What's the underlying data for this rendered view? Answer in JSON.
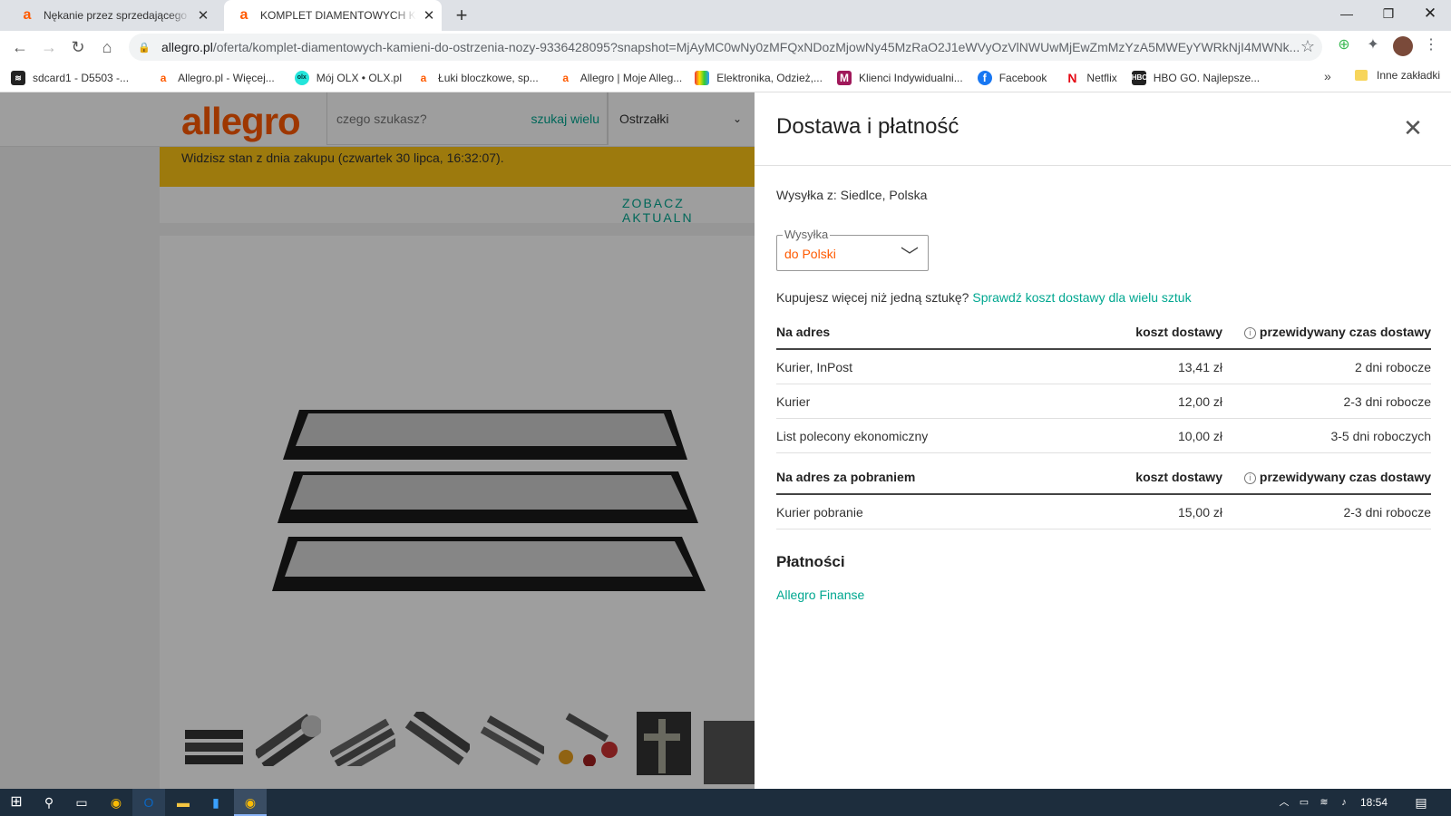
{
  "browser": {
    "tabs": [
      {
        "title": "Nękanie przez sprzedającego za"
      },
      {
        "title": "KOMPLET DIAMENTOWYCH KAMIENI DO OSTRZENIA NOŻY"
      }
    ],
    "url_domain": "allegro.pl",
    "url_path": "/oferta/komplet-diamentowych-kamieni-do-ostrzenia-nozy-9336428095?snapshot=MjAyMC0wNy0zMFQxNDozMjowNy45MzRaO2J1eWVyOzVlNWUwMjEwZmMzYzA5MWEyYWRkNjI4MWNk...",
    "bookmarks": [
      {
        "label": "sdcard1 - D5503 -..."
      },
      {
        "label": "Allegro.pl - Więcej..."
      },
      {
        "label": "Mój OLX • OLX.pl"
      },
      {
        "label": "Łuki bloczkowe, sp..."
      },
      {
        "label": "Allegro | Moje Alleg..."
      },
      {
        "label": "Elektronika, Odzież,..."
      },
      {
        "label": "Klienci Indywidualni..."
      },
      {
        "label": "Facebook"
      },
      {
        "label": "Netflix"
      },
      {
        "label": "HBO GO. Najlepsze..."
      }
    ],
    "more_bookmarks": "»",
    "other_bookmarks": "Inne zakładki"
  },
  "page": {
    "logo": "allegro",
    "search_placeholder": "czego szukasz?",
    "search_multi": "szukaj wielu",
    "category": "Ostrzałki",
    "notice": "Widzisz stan z dnia zakupu (czwartek 30 lipca, 16:32:07).",
    "see_actual": "ZOBACZ AKTUALN"
  },
  "panel": {
    "title": "Dostawa i płatność",
    "ship_from": "Wysyłka z: Siedlce, Polska",
    "dest_legend": "Wysyłka",
    "dest_value": "do Polski",
    "more_question": "Kupujesz więcej niż jedną sztukę?",
    "more_link": "Sprawdź koszt dostawy dla wielu sztuk",
    "table1": {
      "col1": "Na adres",
      "col2": "koszt dostawy",
      "col3": "przewidywany czas dostawy",
      "rows": [
        {
          "name": "Kurier, InPost",
          "cost": "13,41 zł",
          "time": "2 dni robocze"
        },
        {
          "name": "Kurier",
          "cost": "12,00 zł",
          "time": "2-3 dni robocze"
        },
        {
          "name": "List polecony ekonomiczny",
          "cost": "10,00 zł",
          "time": "3-5 dni roboczych"
        }
      ]
    },
    "table2": {
      "col1": "Na adres za pobraniem",
      "col2": "koszt dostawy",
      "col3": "przewidywany czas dostawy",
      "rows": [
        {
          "name": "Kurier pobranie",
          "cost": "15,00 zł",
          "time": "2-3 dni robocze"
        }
      ]
    },
    "payments_title": "Płatności",
    "payments_link": "Allegro Finanse"
  },
  "taskbar": {
    "clock": "18:54"
  },
  "colors": {
    "accent": "#ff5a00",
    "link": "#00a790",
    "notice": "#fec515"
  }
}
